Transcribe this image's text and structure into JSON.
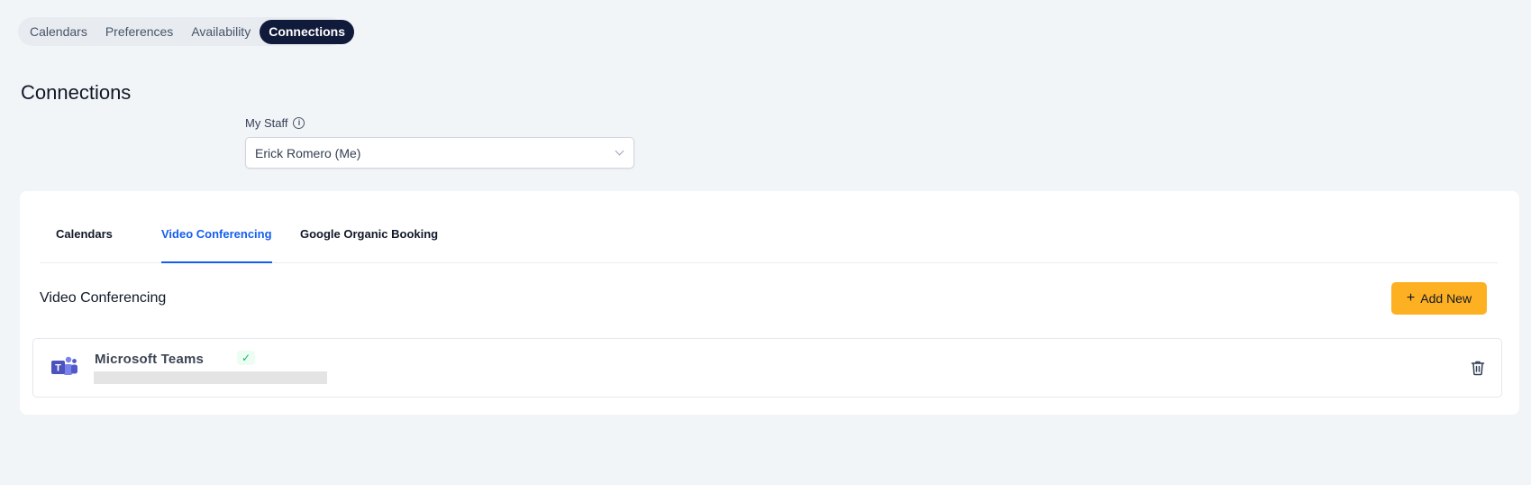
{
  "top_nav": {
    "items": [
      {
        "label": "Calendars",
        "active": false
      },
      {
        "label": "Preferences",
        "active": false
      },
      {
        "label": "Availability",
        "active": false
      },
      {
        "label": "Connections",
        "active": true
      }
    ]
  },
  "page": {
    "title": "Connections"
  },
  "staff": {
    "label": "My Staff",
    "selected": "Erick Romero (Me)"
  },
  "tabs": [
    {
      "label": "Calendars",
      "active": false
    },
    {
      "label": "Video Conferencing",
      "active": true
    },
    {
      "label": "Google Organic Booking",
      "active": false
    }
  ],
  "section": {
    "title": "Video Conferencing",
    "add_button": "Add New"
  },
  "connections": [
    {
      "name": "Microsoft Teams",
      "status_icon": "check-icon",
      "icon": "microsoft-teams-icon"
    }
  ],
  "colors": {
    "accent": "#155eef",
    "nav_active": "#101a3a",
    "add_button": "#fdb022",
    "success": "#12b76a"
  }
}
